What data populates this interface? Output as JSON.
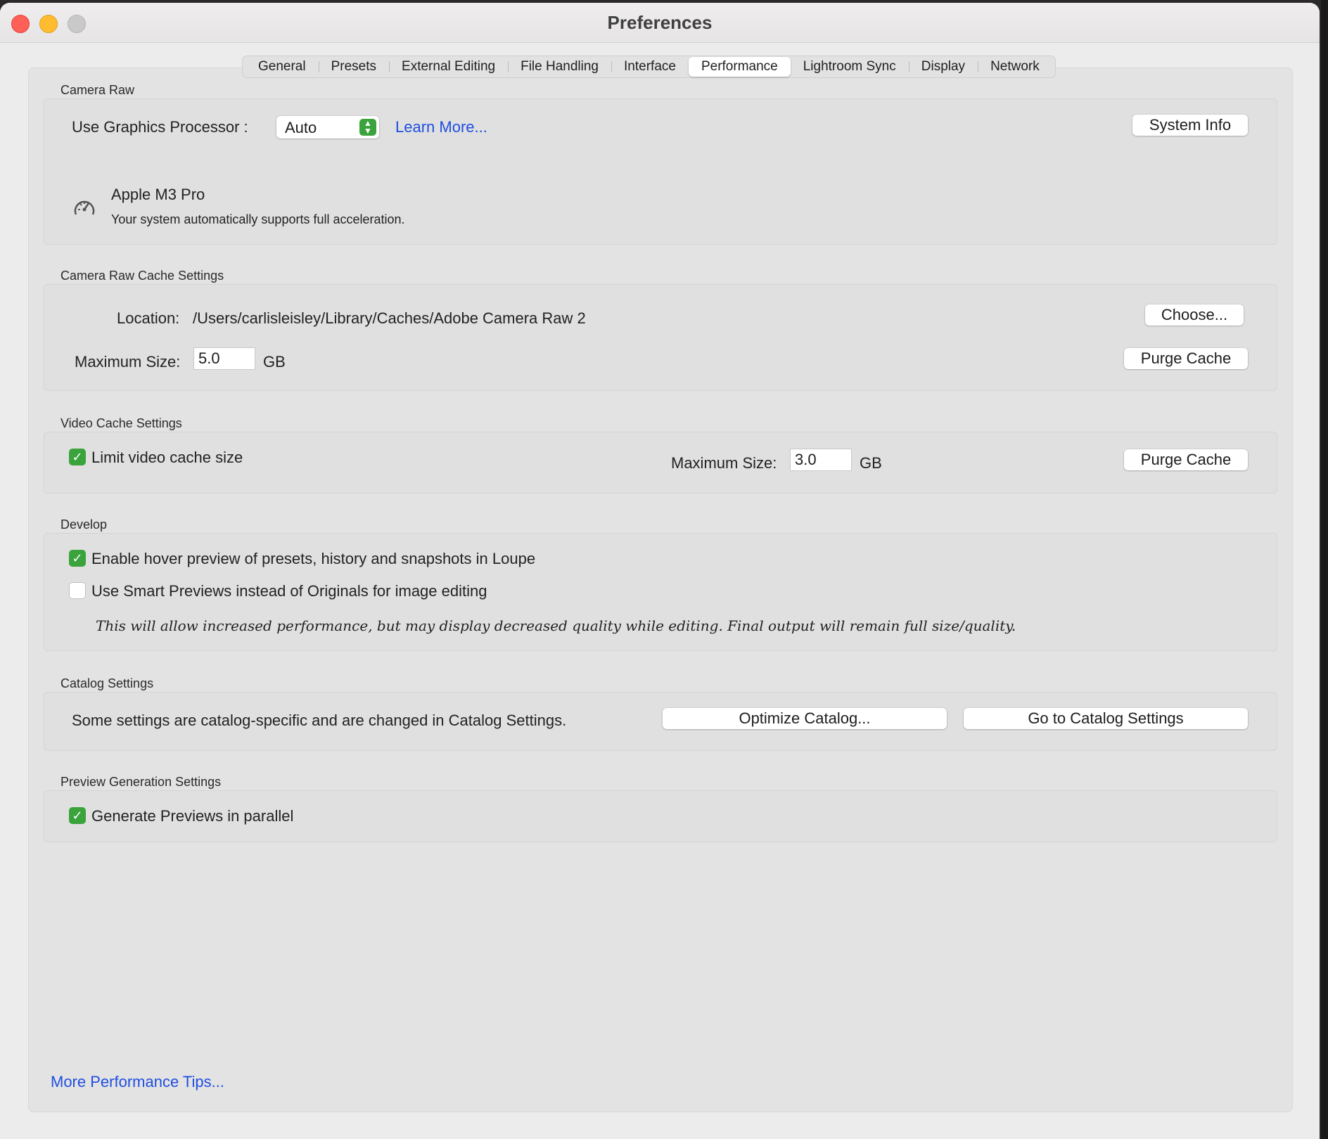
{
  "window": {
    "title": "Preferences"
  },
  "tabs": [
    "General",
    "Presets",
    "External Editing",
    "File Handling",
    "Interface",
    "Performance",
    "Lightroom Sync",
    "Display",
    "Network"
  ],
  "active_tab": "Performance",
  "camera_raw": {
    "label": "Camera Raw",
    "gpu_label": "Use Graphics Processor :",
    "gpu_value": "Auto",
    "learn_more": "Learn More...",
    "system_info": "System Info",
    "device_name": "Apple M3 Pro",
    "device_status": "Your system automatically supports full acceleration.",
    "device_icon": "gauge-icon"
  },
  "cache": {
    "label": "Camera Raw Cache Settings",
    "location_label": "Location:",
    "location_value": "/Users/carlisleisley/Library/Caches/Adobe Camera Raw 2",
    "choose": "Choose...",
    "max_label": "Maximum Size:",
    "max_value": "5.0",
    "unit": "GB",
    "purge": "Purge Cache"
  },
  "video": {
    "label": "Video Cache Settings",
    "limit_label": "Limit video cache size",
    "limit_checked": true,
    "max_label": "Maximum Size:",
    "max_value": "3.0",
    "unit": "GB",
    "purge": "Purge Cache"
  },
  "develop": {
    "label": "Develop",
    "hover_label": "Enable hover preview of presets, history and snapshots in Loupe",
    "hover_checked": true,
    "smart_label": "Use Smart Previews instead of Originals for image editing",
    "smart_checked": false,
    "note": "This will allow increased performance, but may display decreased quality while editing. Final output will remain full size/quality."
  },
  "catalog": {
    "label": "Catalog Settings",
    "text": "Some settings are catalog-specific and are changed in Catalog Settings.",
    "optimize": "Optimize Catalog...",
    "goto": "Go to Catalog Settings"
  },
  "preview": {
    "label": "Preview Generation Settings",
    "parallel_label": "Generate Previews in parallel",
    "parallel_checked": true
  },
  "footer": {
    "tips": "More Performance Tips..."
  },
  "colors": {
    "check_green": "#3aa33c",
    "link_blue": "#1f4ee0"
  }
}
